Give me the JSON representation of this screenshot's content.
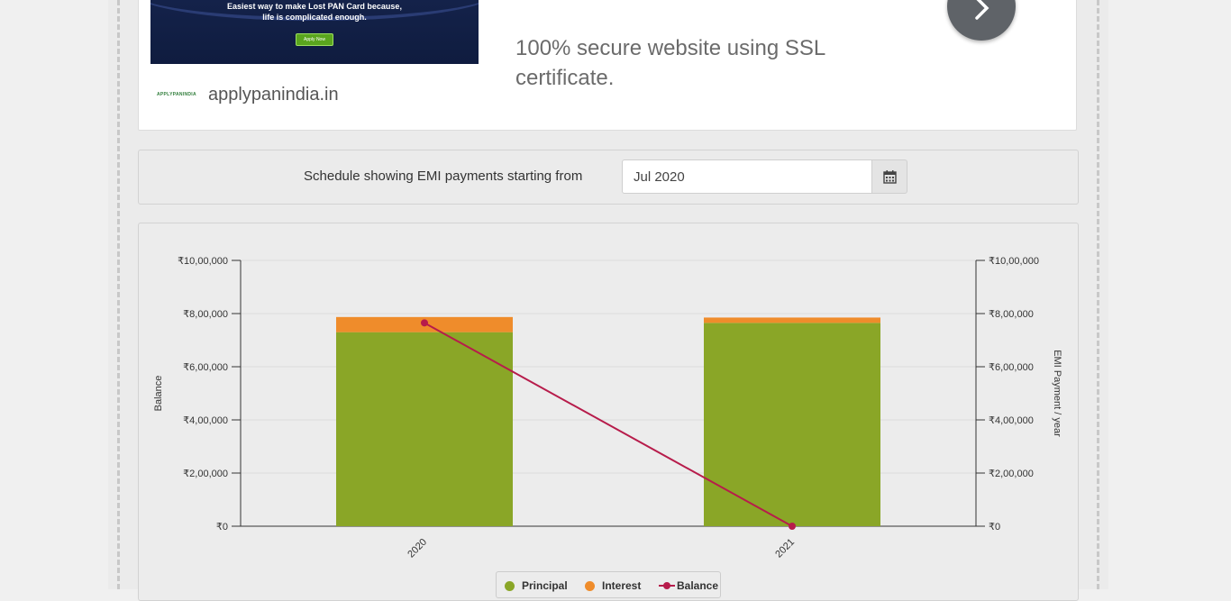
{
  "ad": {
    "banner_line1": "Easiest way to make Lost PAN Card because,",
    "banner_line2": "life is complicated enough.",
    "banner_button": "Apply Now",
    "logo_text": "APPLYPANINDIA",
    "domain": "applypanindia.in",
    "headline": "100% secure website using SSL certificate.",
    "next_icon": "chevron-right-icon"
  },
  "schedule": {
    "label": "Schedule showing EMI payments starting from",
    "value": "Jul 2020",
    "calendar_icon": "calendar-icon"
  },
  "legend": {
    "principal": "Principal",
    "interest": "Interest",
    "balance": "Balance"
  },
  "chart_data": {
    "type": "bar",
    "categories": [
      "2020",
      "2021"
    ],
    "series": [
      {
        "name": "Principal",
        "type": "bar",
        "stack": true,
        "color": "#8aa627",
        "values": [
          730000,
          765000
        ]
      },
      {
        "name": "Interest",
        "type": "bar",
        "stack": true,
        "color": "#ef8c2b",
        "values": [
          57000,
          20000
        ]
      },
      {
        "name": "Balance",
        "type": "line",
        "color": "#b71c4b",
        "values": [
          765000,
          0
        ]
      }
    ],
    "ylabel_left": "Balance",
    "ylabel_right": "EMI Payment / year",
    "ylim": [
      0,
      1000000
    ],
    "yticks": [
      "₹0",
      "₹2,00,000",
      "₹4,00,000",
      "₹6,00,000",
      "₹8,00,000",
      "₹10,00,000"
    ],
    "grid": true
  }
}
